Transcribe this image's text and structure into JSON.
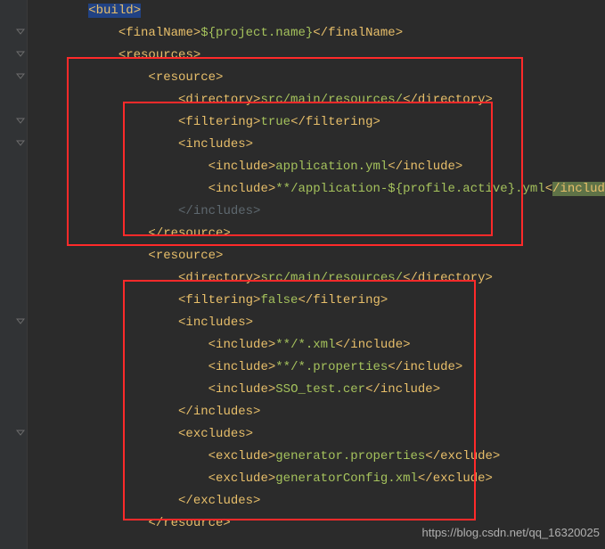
{
  "lines": [
    {
      "segs": [
        {
          "cls": "sel",
          "t": "<build>"
        }
      ],
      "indent": 8
    },
    {
      "segs": [
        {
          "cls": "tag",
          "t": "<finalName>"
        },
        {
          "cls": "txt",
          "t": "${project.name}"
        },
        {
          "cls": "tag",
          "t": "</finalName>"
        }
      ],
      "indent": 12
    },
    {
      "segs": [
        {
          "cls": "tag",
          "t": "<resources>"
        }
      ],
      "indent": 12
    },
    {
      "segs": [
        {
          "cls": "tag",
          "t": "<resource>"
        }
      ],
      "indent": 16
    },
    {
      "segs": [
        {
          "cls": "tag",
          "t": "<directory>"
        },
        {
          "cls": "txt",
          "t": "src/main/resources/"
        },
        {
          "cls": "tag",
          "t": "</directory>"
        }
      ],
      "indent": 20
    },
    {
      "segs": [
        {
          "cls": "tag",
          "t": "<filtering>"
        },
        {
          "cls": "txt",
          "t": "true"
        },
        {
          "cls": "tag",
          "t": "</filtering>"
        }
      ],
      "indent": 20
    },
    {
      "segs": [
        {
          "cls": "tag",
          "t": "<includes>"
        }
      ],
      "indent": 20
    },
    {
      "segs": [
        {
          "cls": "tag",
          "t": "<include>"
        },
        {
          "cls": "txt",
          "t": "application.yml"
        },
        {
          "cls": "tag",
          "t": "</include>"
        }
      ],
      "indent": 24
    },
    {
      "segs": [
        {
          "cls": "tag",
          "t": "<include>"
        },
        {
          "cls": "txt",
          "t": "**/application-${profile.active}.yml"
        },
        {
          "cls": "tag",
          "t": "<"
        },
        {
          "cls": "hlgreen",
          "t": "/include"
        },
        {
          "cls": "tag",
          "t": ">"
        }
      ],
      "indent": 24
    },
    {
      "segs": [
        {
          "cls": "dim",
          "t": "</includes>"
        }
      ],
      "indent": 20
    },
    {
      "segs": [
        {
          "cls": "tag",
          "t": "</resource>"
        }
      ],
      "indent": 16
    },
    {
      "segs": [
        {
          "cls": "tag",
          "t": "<resource>"
        }
      ],
      "indent": 16
    },
    {
      "segs": [
        {
          "cls": "tag",
          "t": "<directory>"
        },
        {
          "cls": "txt",
          "t": "src/main/resources/"
        },
        {
          "cls": "tag",
          "t": "</directory>"
        }
      ],
      "indent": 20
    },
    {
      "segs": [
        {
          "cls": "tag",
          "t": "<filtering>"
        },
        {
          "cls": "txt",
          "t": "false"
        },
        {
          "cls": "tag",
          "t": "</filtering>"
        }
      ],
      "indent": 20
    },
    {
      "segs": [
        {
          "cls": "tag",
          "t": "<includes>"
        }
      ],
      "indent": 20
    },
    {
      "segs": [
        {
          "cls": "tag",
          "t": "<include>"
        },
        {
          "cls": "txt",
          "t": "**/*.xml"
        },
        {
          "cls": "tag",
          "t": "</include>"
        }
      ],
      "indent": 24
    },
    {
      "segs": [
        {
          "cls": "tag",
          "t": "<include>"
        },
        {
          "cls": "txt",
          "t": "**/*.properties"
        },
        {
          "cls": "tag",
          "t": "</include>"
        }
      ],
      "indent": 24
    },
    {
      "segs": [
        {
          "cls": "tag",
          "t": "<include>"
        },
        {
          "cls": "txt",
          "t": "SSO_test.cer"
        },
        {
          "cls": "tag",
          "t": "</include>"
        }
      ],
      "indent": 24
    },
    {
      "segs": [
        {
          "cls": "tag",
          "t": "</includes>"
        }
      ],
      "indent": 20
    },
    {
      "segs": [
        {
          "cls": "tag",
          "t": "<excludes>"
        }
      ],
      "indent": 20
    },
    {
      "segs": [
        {
          "cls": "tag",
          "t": "<exclude>"
        },
        {
          "cls": "txt",
          "t": "generator.properties"
        },
        {
          "cls": "tag",
          "t": "</exclude>"
        }
      ],
      "indent": 24
    },
    {
      "segs": [
        {
          "cls": "tag",
          "t": "<exclude>"
        },
        {
          "cls": "txt",
          "t": "generatorConfig.xml"
        },
        {
          "cls": "tag",
          "t": "</exclude>"
        }
      ],
      "indent": 24
    },
    {
      "segs": [
        {
          "cls": "tag",
          "t": "</excludes>"
        }
      ],
      "indent": 20
    },
    {
      "segs": [
        {
          "cls": "tag",
          "t": "</resource>"
        }
      ],
      "indent": 16
    }
  ],
  "fold_rows": [
    1,
    2,
    3,
    5,
    6,
    14,
    19
  ],
  "watermark": "https://blog.csdn.net/qq_16320025"
}
